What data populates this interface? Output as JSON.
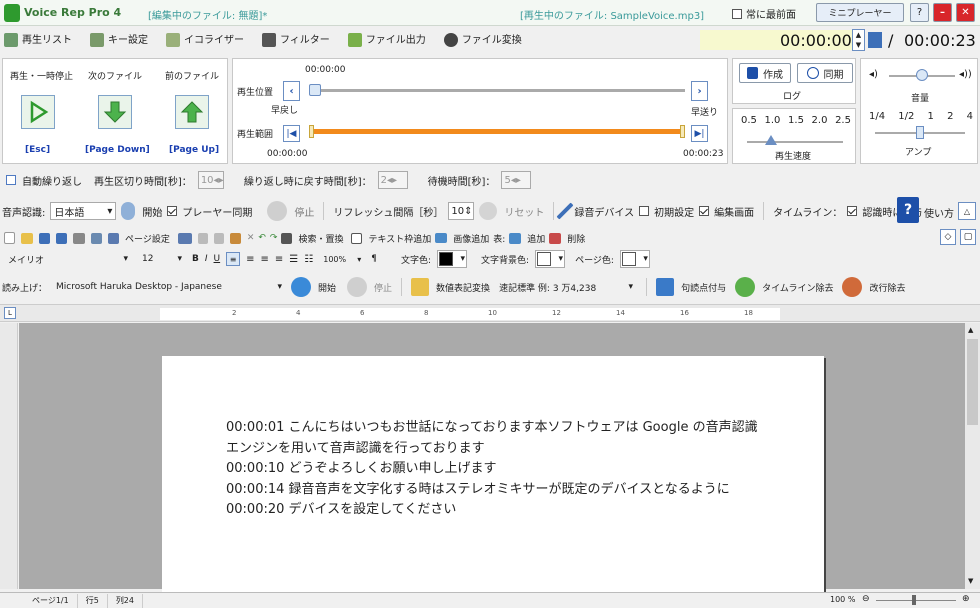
{
  "app": {
    "logo": "Voice Rep Pro 4",
    "editing_file": "[編集中のファイル: 無題]*",
    "playing_file": "[再生中のファイル: SampleVoice.mp3]",
    "always_on_top": "常に最前面",
    "mini_player": "ミニプレーヤー"
  },
  "menu": {
    "items": [
      "再生リスト",
      "キー設定",
      "イコライザー",
      "フィルター",
      "ファイル出力",
      "ファイル変換"
    ],
    "time_current": "00:00:00",
    "time_separator": "/",
    "time_total": "00:00:23"
  },
  "controls": {
    "play_pause": "再生・一時停止",
    "next_file": "次のファイル",
    "prev_file": "前のファイル",
    "key_esc": "[Esc]",
    "key_pagedown": "[Page Down]",
    "key_pageup": "[Page Up]",
    "position_label": "再生位置",
    "position_time": "00:00:00",
    "rewind": "早戻し",
    "forward": "早送り",
    "range_label": "再生範囲",
    "range_start": "00:00:00",
    "range_end": "00:00:23",
    "position_value": 0.0,
    "range_start_value": 0.0,
    "range_end_value": 1.0,
    "create": "作成",
    "sync": "同期",
    "log": "ログ",
    "speed_ticks": [
      "0.5",
      "1.0",
      "1.5",
      "2.0",
      "2.5"
    ],
    "speed_label": "再生速度",
    "speed_value": "1.0",
    "volume_label": "音量",
    "volume_value": 0.5,
    "amp_ticks": [
      "1/4",
      "1/2",
      "1",
      "2",
      "4"
    ],
    "amp_label": "アンプ",
    "amp_value": "1"
  },
  "repeat": {
    "auto_repeat": "自動繰り返し",
    "segment_label": "再生区切り時間[秒]：",
    "segment_value": "10",
    "back_label": "繰り返し時に戻す時間[秒]：",
    "back_value": "2",
    "wait_label": "待機時間[秒]：",
    "wait_value": "5"
  },
  "recognition": {
    "label": "音声認識:",
    "language": "日本語",
    "start": "開始",
    "player_sync": "プレーヤー同期",
    "stop": "停止",
    "refresh_label": "リフレッシュ間隔［秒］",
    "refresh_value": "10",
    "reset": "リセット",
    "rec_device": "録音デバイス",
    "initial_settings": "初期設定",
    "edit_screen": "編集画面",
    "timeline_label": "タイムライン：",
    "timeline_on_recognize": "認識時に付与",
    "how_to": "使い方"
  },
  "edit_toolbar": {
    "page_settings": "ページ設定",
    "search_replace": "検索・置換",
    "text_frame": "テキスト枠追加",
    "image_add": "画像追加",
    "table_label": "表:",
    "table_add": "追加",
    "table_delete": "削除"
  },
  "format": {
    "font": "メイリオ",
    "size": "12",
    "bold": "B",
    "italic": "I",
    "underline": "U",
    "zoom": "100%",
    "para": "¶",
    "text_color_label": "文字色:",
    "bg_color_label": "文字背景色:",
    "page_color_label": "ページ色:",
    "text_color": "#000000",
    "bg_color": "#ffffff",
    "page_color": "#ffffff"
  },
  "tts": {
    "label": "読み上げ：",
    "voice": "Microsoft Haruka Desktop - Japanese",
    "start": "開始",
    "stop": "停止",
    "numeric": "数値表記変換",
    "notation": "速記標準 例: 3 万4,238",
    "punct": "句読点付与",
    "timeline_remove": "タイムライン除去",
    "newline_remove": "改行除去"
  },
  "ruler": {
    "marks": [
      "2",
      "4",
      "6",
      "8",
      "10",
      "12",
      "14",
      "16",
      "18"
    ]
  },
  "document": {
    "lines": [
      "00:00:01  こんにちはいつもお世話になっております本ソフトウェアは Google の音声認識",
      "エンジンを用いて音声認識を行っております",
      "00:00:10  どうぞよろしくお願い申し上げます",
      "00:00:14  録音音声を文字化する時はステレオミキサーが既定のデバイスとなるように",
      "00:00:20  デバイスを設定してください"
    ]
  },
  "status": {
    "page": "ページ1/1",
    "line": "行5",
    "col": "列24",
    "zoom": "100 %"
  },
  "colors": {
    "accent_green": "#2e9a2e",
    "progress_orange": "#f28a1c",
    "help_blue": "#1d4fa8"
  }
}
